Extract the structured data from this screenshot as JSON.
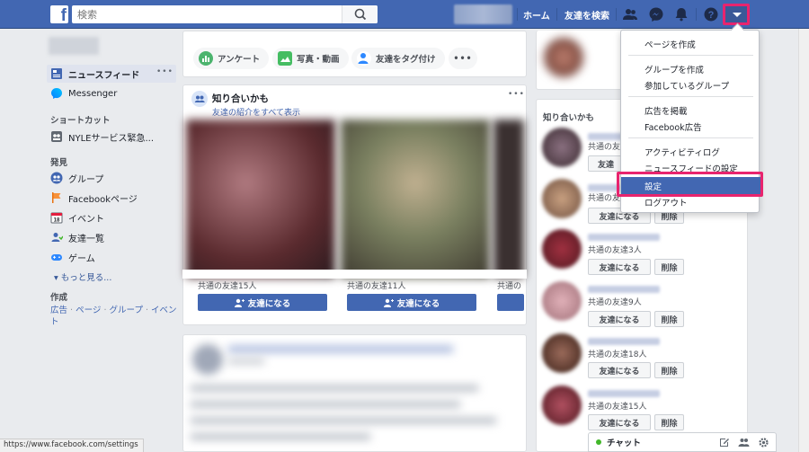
{
  "topbar": {
    "search_placeholder": "検索",
    "home": "ホーム",
    "find_friends": "友達を検索"
  },
  "left_nav": {
    "news_feed": "ニュースフィード",
    "messenger": "Messenger",
    "shortcuts_heading": "ショートカット",
    "shortcut_item": "NYLEサービス緊急...",
    "explore_heading": "発見",
    "explore_items": [
      "グループ",
      "Facebookページ",
      "イベント",
      "友達一覧",
      "ゲーム"
    ],
    "see_more": "▾ もっと見る...",
    "create_heading": "作成",
    "create_links": [
      "広告",
      "ページ",
      "グループ",
      "イベント"
    ],
    "create_separator": "·"
  },
  "composer": {
    "buttons": [
      "アンケート",
      "写真・動画",
      "友達をタグ付け"
    ],
    "more": "•••"
  },
  "pymk": {
    "title": "知り合いかも",
    "see_all": "友達の紹介をすべて表示",
    "more": "•••",
    "cards": [
      {
        "mutual": "共通の友達15人",
        "button": "友達になる"
      },
      {
        "mutual": "共通の友達11人",
        "button": "友達になる"
      },
      {
        "mutual": "共通の",
        "button": ""
      }
    ]
  },
  "right_col": {
    "heading": "知り合いかも",
    "rows": [
      {
        "mutual": "共通の友",
        "add": "友達",
        "delete": ""
      },
      {
        "mutual": "共通の友",
        "add": "友達になる",
        "delete": "削除"
      },
      {
        "mutual": "共通の友達3人",
        "add": "友達になる",
        "delete": "削除"
      },
      {
        "mutual": "共通の友達9人",
        "add": "友達になる",
        "delete": "削除"
      },
      {
        "mutual": "共通の友達18人",
        "add": "友達になる",
        "delete": "削除"
      },
      {
        "mutual": "共通の友達15人",
        "add": "友達になる",
        "delete": "削除"
      }
    ]
  },
  "dropdown": {
    "items": [
      "ページを作成",
      "グループを作成",
      "参加しているグループ",
      "広告を掲載",
      "Facebook広告",
      "アクティビティログ",
      "ニュースフィードの設定",
      "設定",
      "ログアウト"
    ]
  },
  "status_url": "https://www.facebook.com/settings",
  "chat": {
    "label": "チャット",
    "status_color": "#42b72a"
  },
  "colors": {
    "brand": "#4267b2",
    "highlight_border": "#e8246e",
    "background": "#e9ebee"
  }
}
